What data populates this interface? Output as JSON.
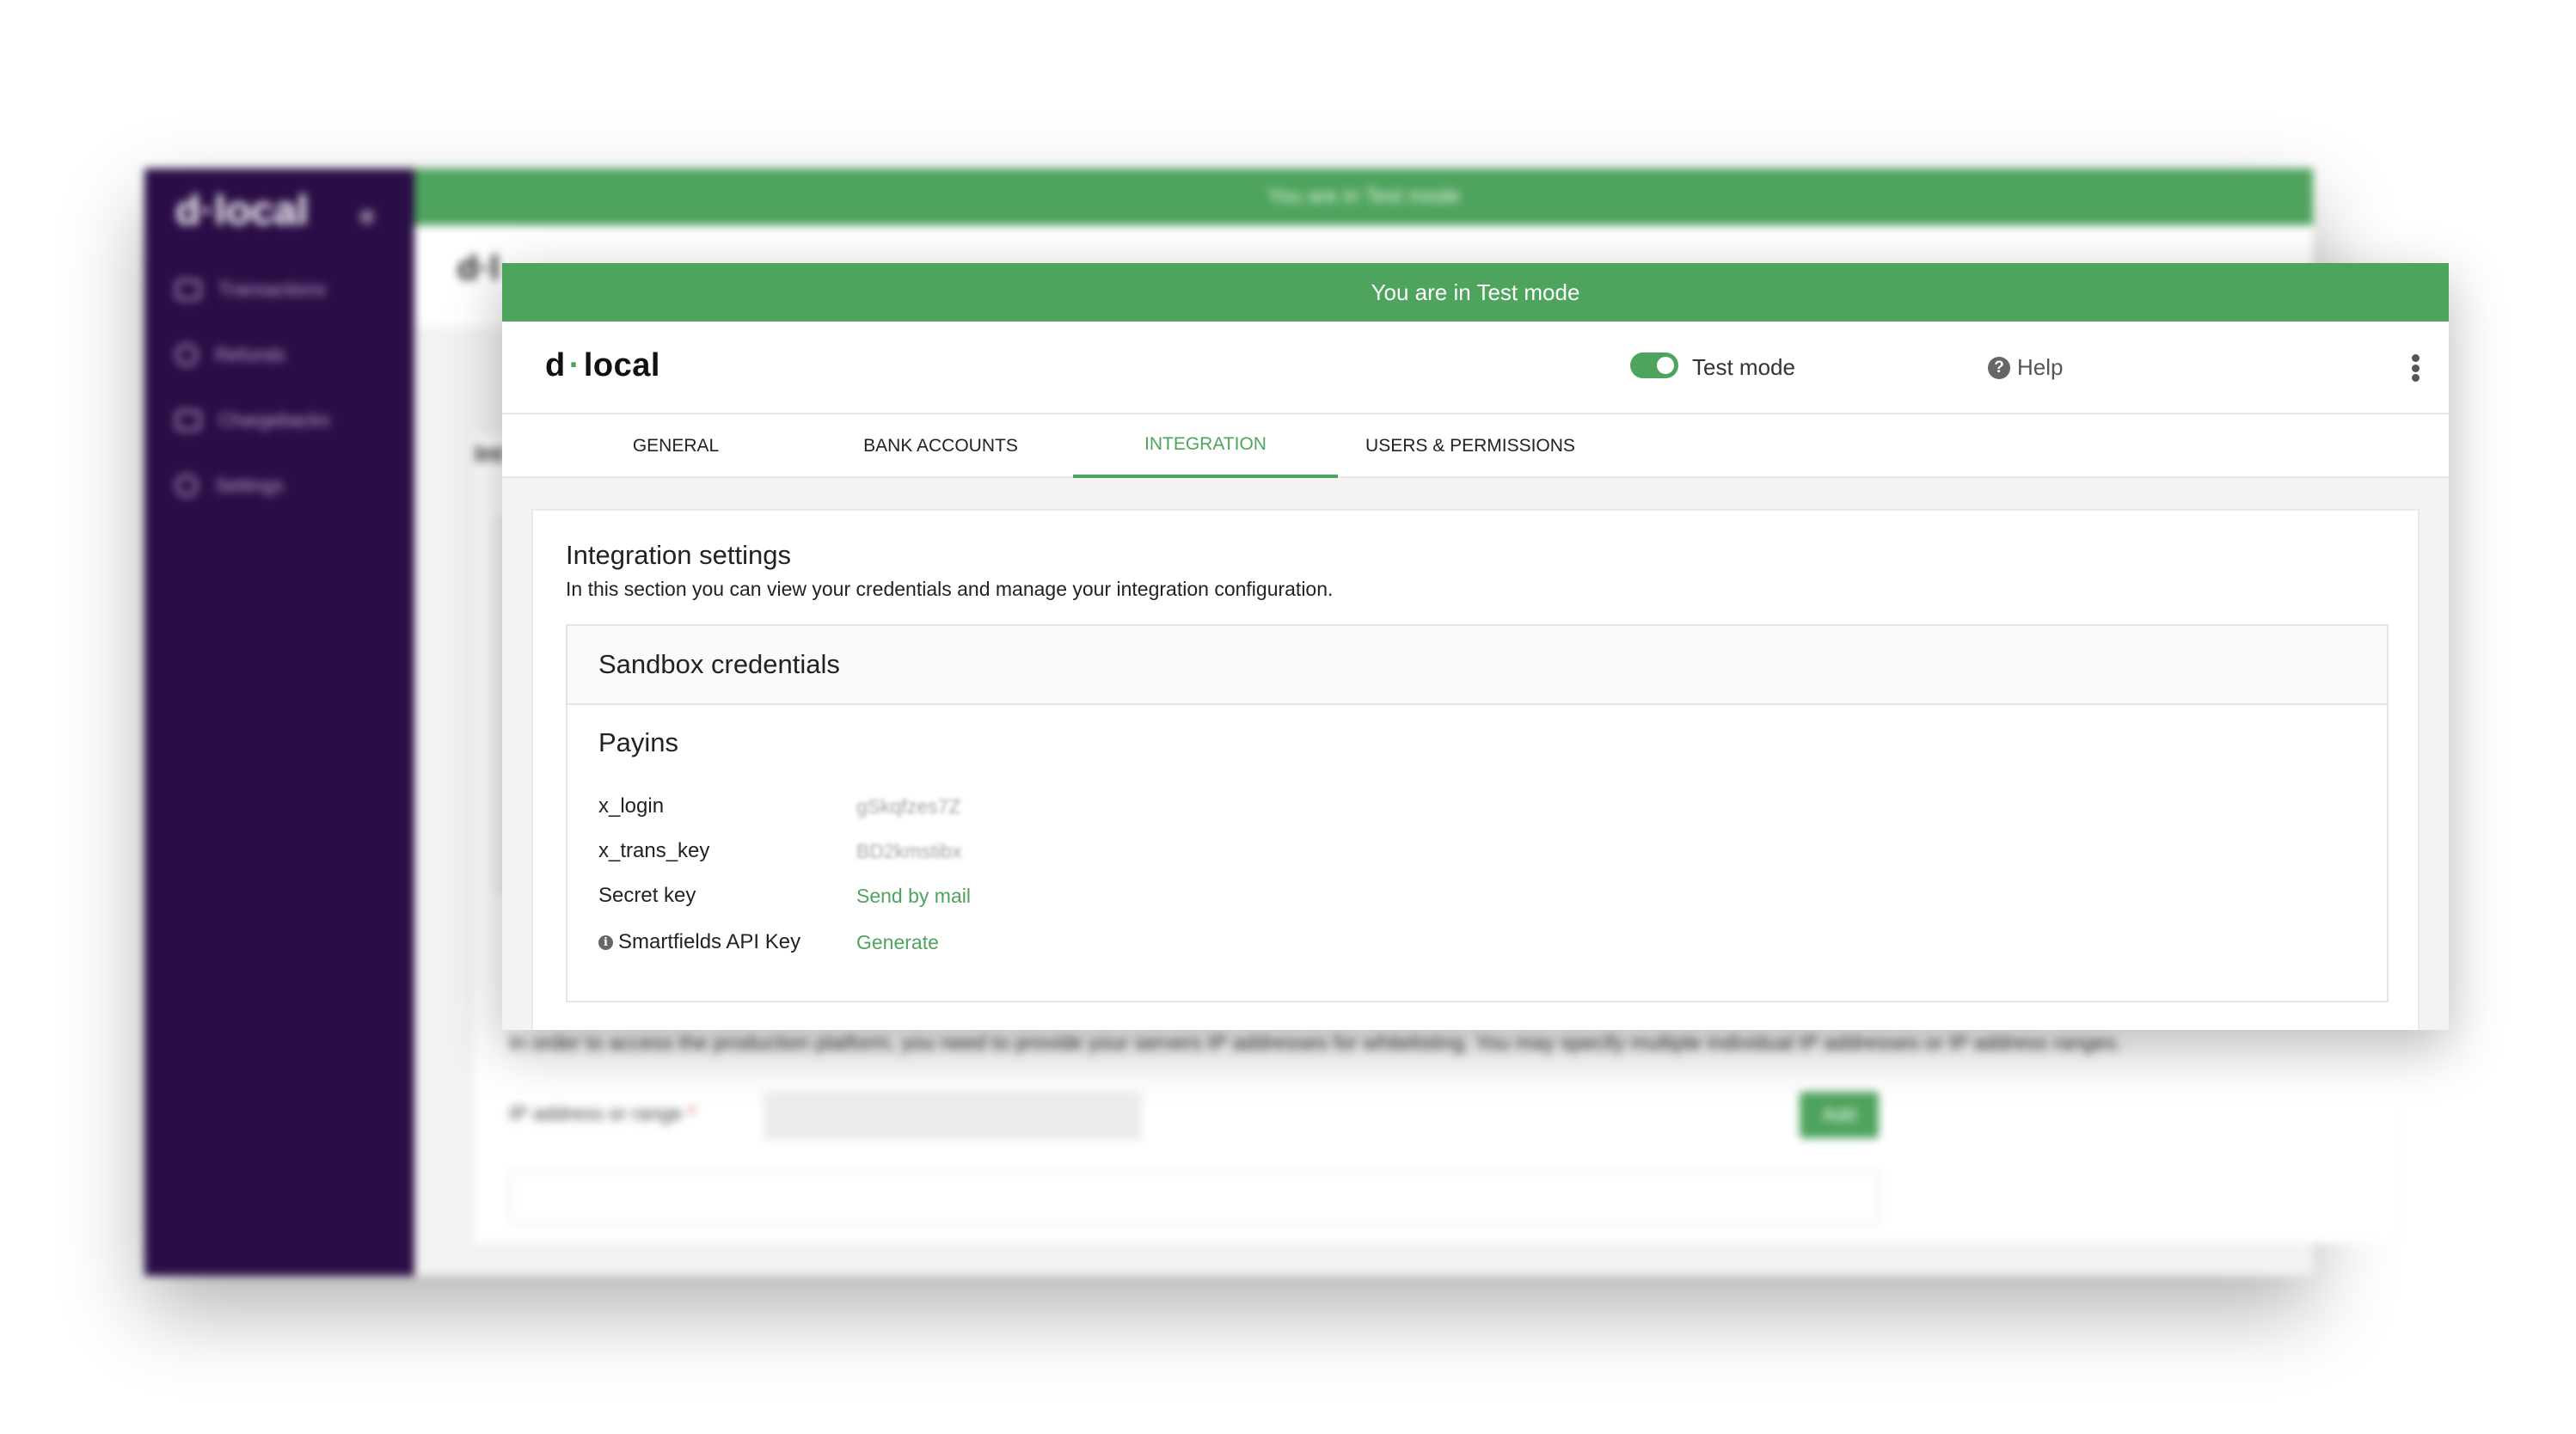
{
  "background": {
    "sidebar": {
      "logo": "d·local",
      "items": [
        {
          "label": "Transactions"
        },
        {
          "label": "Refunds"
        },
        {
          "label": "Chargebacks"
        },
        {
          "label": "Settings"
        }
      ]
    },
    "banner": "You are in Test mode",
    "logo": "d·l",
    "heading": "Int",
    "ip_text": "In order to access the production platform, you need to provide your servers IP addresses for whitelisting. You may specify multiple individual IP addresses or IP address ranges.",
    "ip_label": "IP address or range",
    "ip_required": "*",
    "add_label": "Add"
  },
  "banner": "You are in Test mode",
  "header": {
    "logo_left": "d",
    "logo_dot": "·",
    "logo_right": "local",
    "test_mode_label": "Test mode",
    "help_label": "Help"
  },
  "tabs": [
    {
      "label": "GENERAL",
      "active": false
    },
    {
      "label": "BANK ACCOUNTS",
      "active": false
    },
    {
      "label": "INTEGRATION",
      "active": true
    },
    {
      "label": "USERS & PERMISSIONS",
      "active": false
    }
  ],
  "integration": {
    "title": "Integration settings",
    "description": "In this section you can view your credentials and manage your integration configuration.",
    "card_title": "Sandbox credentials",
    "section": "Payins",
    "rows": [
      {
        "label": "x_login",
        "value": "gSkqfzes7Z"
      },
      {
        "label": "x_trans_key",
        "value": "BD2kmstibx"
      },
      {
        "label": "Secret key",
        "value": "Send by mail"
      },
      {
        "label": "Smartfields API Key",
        "value": "Generate"
      }
    ]
  },
  "colors": {
    "brand_green": "#4ea35d",
    "sidebar_purple": "#2a0d46"
  }
}
